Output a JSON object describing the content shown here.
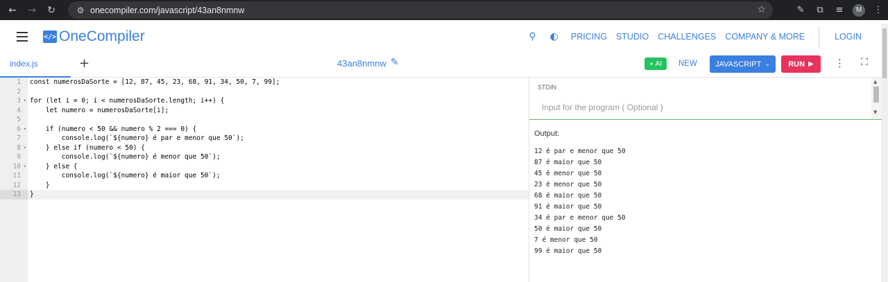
{
  "browser": {
    "url": "onecompiler.com/javascript/43an8nmnw",
    "profile_initial": "M",
    "icons": [
      "back-icon",
      "forward-icon",
      "reload-icon",
      "site-settings-icon",
      "star-icon",
      "eyedropper-icon",
      "extensions-icon",
      "media-queue-icon",
      "menu-icon"
    ]
  },
  "header": {
    "logo_mark": "</>",
    "logo_text": "OneCompiler",
    "nav": {
      "pricing": "PRICING",
      "studio": "STUDIO",
      "challenges": "CHALLENGES",
      "company": "COMPANY & MORE",
      "login": "LOGIN"
    }
  },
  "toolbar": {
    "tab": "index.js",
    "add_tab": "+",
    "code_id": "43an8nmnw",
    "ai_label": "AI",
    "new_label": "NEW",
    "language_label": "JAVASCRIPT",
    "run_label": "RUN"
  },
  "editor": {
    "line_numbers": [
      "1",
      "2",
      "3",
      "4",
      "5",
      "6",
      "7",
      "8",
      "9",
      "10",
      "11",
      "12",
      "13"
    ],
    "fold_markers": [
      "",
      "",
      "▾",
      "",
      "",
      "▾",
      "",
      "▾",
      "",
      "▾",
      "",
      "",
      ""
    ],
    "lines": [
      "const numerosDaSorte = [12, 87, 45, 23, 68, 91, 34, 50, 7, 99];",
      "",
      "for (let i = 0; i < numerosDaSorte.length; i++) {",
      "    let numero = numerosDaSorte[i];",
      "",
      "    if (numero < 50 && numero % 2 === 0) {",
      "        console.log(`${numero} é par e menor que 50`);",
      "    } else if (numero < 50) {",
      "        console.log(`${numero} é menor que 50`);",
      "    } else {",
      "        console.log(`${numero} é maior que 50`);",
      "    }",
      "}"
    ],
    "active_line": 13
  },
  "stdin": {
    "label": "STDIN",
    "placeholder": "Input for the program ( Optional )"
  },
  "output": {
    "label": "Output:",
    "lines": [
      "12 é par e menor que 50",
      "87 é maior que 50",
      "45 é menor que 50",
      "23 é menor que 50",
      "68 é maior que 50",
      "91 é maior que 50",
      "34 é par e menor que 50",
      "50 é maior que 50",
      "7 é menor que 50",
      "99 é maior que 50"
    ]
  },
  "colors": {
    "brand_blue": "#3b7fe0",
    "run_pink": "#e8335d",
    "ai_green": "#23c45e",
    "chrome_dark": "#202124"
  }
}
